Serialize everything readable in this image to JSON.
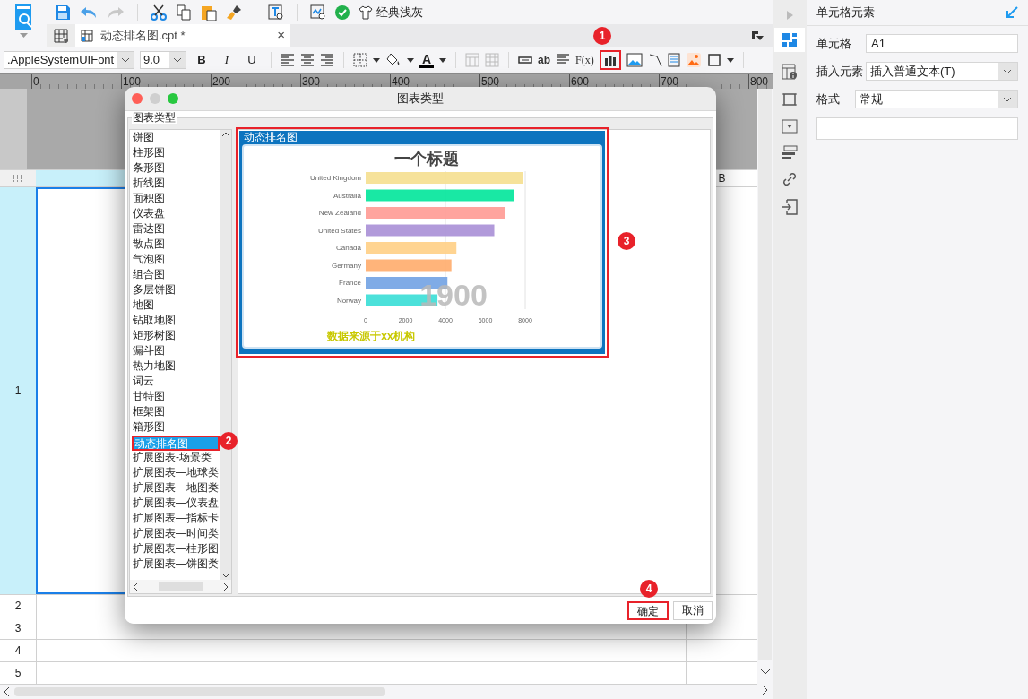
{
  "toolbar": {
    "theme_label": "经典浅灰"
  },
  "tab": {
    "title": "动态排名图.cpt *",
    "close": "×"
  },
  "format_bar": {
    "font": ".AppleSystemUIFont",
    "size": "9.0",
    "style_buttons": [
      "B",
      "I",
      "U"
    ],
    "color_letter": "A",
    "text_tools": [
      "ab",
      "F(x)"
    ]
  },
  "ruler": {
    "ticks": [
      "0",
      "100",
      "200",
      "300",
      "400",
      "500",
      "600",
      "700",
      "800"
    ]
  },
  "sheet": {
    "column_b": "B",
    "rows": [
      "1",
      "2",
      "3",
      "4",
      "5"
    ]
  },
  "side_panel": {
    "title": "单元格元素",
    "fields": [
      {
        "kind": "text",
        "label": "单元格",
        "value": "A1"
      },
      {
        "kind": "select",
        "label": "插入元素",
        "value": "插入普通文本(T)"
      },
      {
        "kind": "select",
        "label": "格式",
        "value": "常规"
      }
    ]
  },
  "dialog": {
    "title": "图表类型",
    "group": "图表类型",
    "types": [
      {
        "label": "饼图",
        "selected": false
      },
      {
        "label": "柱形图",
        "selected": false
      },
      {
        "label": "条形图",
        "selected": false
      },
      {
        "label": "折线图",
        "selected": false
      },
      {
        "label": "面积图",
        "selected": false
      },
      {
        "label": "仪表盘",
        "selected": false
      },
      {
        "label": "雷达图",
        "selected": false
      },
      {
        "label": "散点图",
        "selected": false
      },
      {
        "label": "气泡图",
        "selected": false
      },
      {
        "label": "组合图",
        "selected": false
      },
      {
        "label": "多层饼图",
        "selected": false
      },
      {
        "label": "地图",
        "selected": false
      },
      {
        "label": "钻取地图",
        "selected": false
      },
      {
        "label": "矩形树图",
        "selected": false
      },
      {
        "label": "漏斗图",
        "selected": false
      },
      {
        "label": "热力地图",
        "selected": false
      },
      {
        "label": "词云",
        "selected": false
      },
      {
        "label": "甘特图",
        "selected": false
      },
      {
        "label": "框架图",
        "selected": false
      },
      {
        "label": "箱形图",
        "selected": false
      },
      {
        "label": "动态排名图",
        "selected": true
      },
      {
        "label": "扩展图表-场景类",
        "selected": false
      },
      {
        "label": "扩展图表—地球类",
        "selected": false
      },
      {
        "label": "扩展图表—地图类",
        "selected": false
      },
      {
        "label": "扩展图表—仪表盘",
        "selected": false
      },
      {
        "label": "扩展图表—指标卡",
        "selected": false
      },
      {
        "label": "扩展图表—时间类",
        "selected": false
      },
      {
        "label": "扩展图表—柱形图",
        "selected": false
      },
      {
        "label": "扩展图表—饼图类",
        "selected": false
      }
    ],
    "preview": {
      "label": "动态排名图",
      "watermark": "1900",
      "source": "数据来源于xx机构",
      "chart_data": {
        "type": "bar",
        "orientation": "horizontal",
        "title": "一个标题",
        "categories": [
          "United Kingdom",
          "Australia",
          "New Zealand",
          "United States",
          "Canada",
          "Germany",
          "France",
          "Norway"
        ],
        "series": [
          {
            "values": [
              7900,
              7450,
              7000,
              6450,
              4550,
              4300,
              4100,
              3600
            ]
          }
        ],
        "xlim": [
          0,
          8000
        ],
        "xticks": [
          0,
          2000,
          4000,
          6000,
          8000
        ]
      }
    },
    "buttons": [
      {
        "label": "确定",
        "highlighted": true
      },
      {
        "label": "取消",
        "highlighted": false
      }
    ]
  },
  "callouts": [
    {
      "number": "1"
    },
    {
      "number": "2"
    },
    {
      "number": "3"
    },
    {
      "number": "4"
    }
  ]
}
